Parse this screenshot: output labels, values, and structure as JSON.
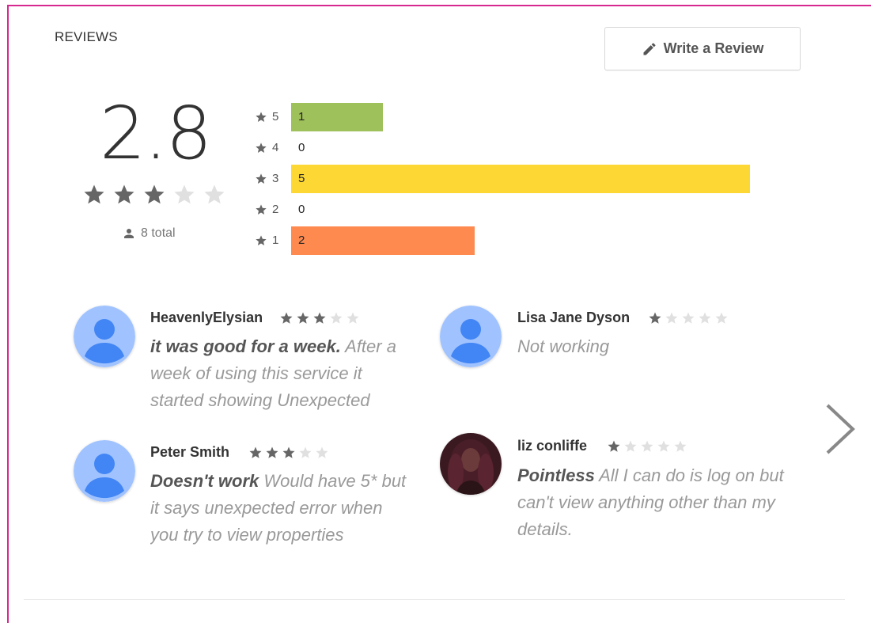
{
  "section_title": "REVIEWS",
  "write_review": {
    "label": "Write a Review",
    "icon": "pencil-icon"
  },
  "summary": {
    "average": "2.8",
    "average_stars": 3,
    "total_label": "8 total",
    "total_icon": "person-icon"
  },
  "histogram": [
    {
      "stars": "5",
      "count": "1",
      "value": 1,
      "color": "#9fc15b"
    },
    {
      "stars": "4",
      "count": "0",
      "value": 0,
      "color": "#9fc15b"
    },
    {
      "stars": "3",
      "count": "5",
      "value": 5,
      "color": "#fdd835"
    },
    {
      "stars": "2",
      "count": "0",
      "value": 0,
      "color": "#fdd835"
    },
    {
      "stars": "1",
      "count": "2",
      "value": 2,
      "color": "#ff8a50"
    }
  ],
  "histogram_max": 5,
  "reviews": [
    {
      "name": "HeavenlyElysian",
      "rating": 3,
      "title": "it was good for a week.",
      "body": "After a week of using this service it started showing Unexpected",
      "avatar": "default-avatar"
    },
    {
      "name": "Lisa Jane Dyson",
      "rating": 1,
      "title": "",
      "body": "Not working",
      "avatar": "default-avatar"
    },
    {
      "name": "Peter Smith",
      "rating": 3,
      "title": "Doesn't work",
      "body": "Would have 5* but it says unexpected error when you try to view properties",
      "avatar": "default-avatar"
    },
    {
      "name": "liz conliffe",
      "rating": 1,
      "title": "Pointless",
      "body": "All I can do is log on but can't view anything other than my details.",
      "avatar": "photo-avatar"
    }
  ],
  "next_icon": "chevron-right-icon",
  "colors": {
    "star_filled": "#666666",
    "star_empty": "#e0e0e0",
    "frame": "#d6288f"
  }
}
